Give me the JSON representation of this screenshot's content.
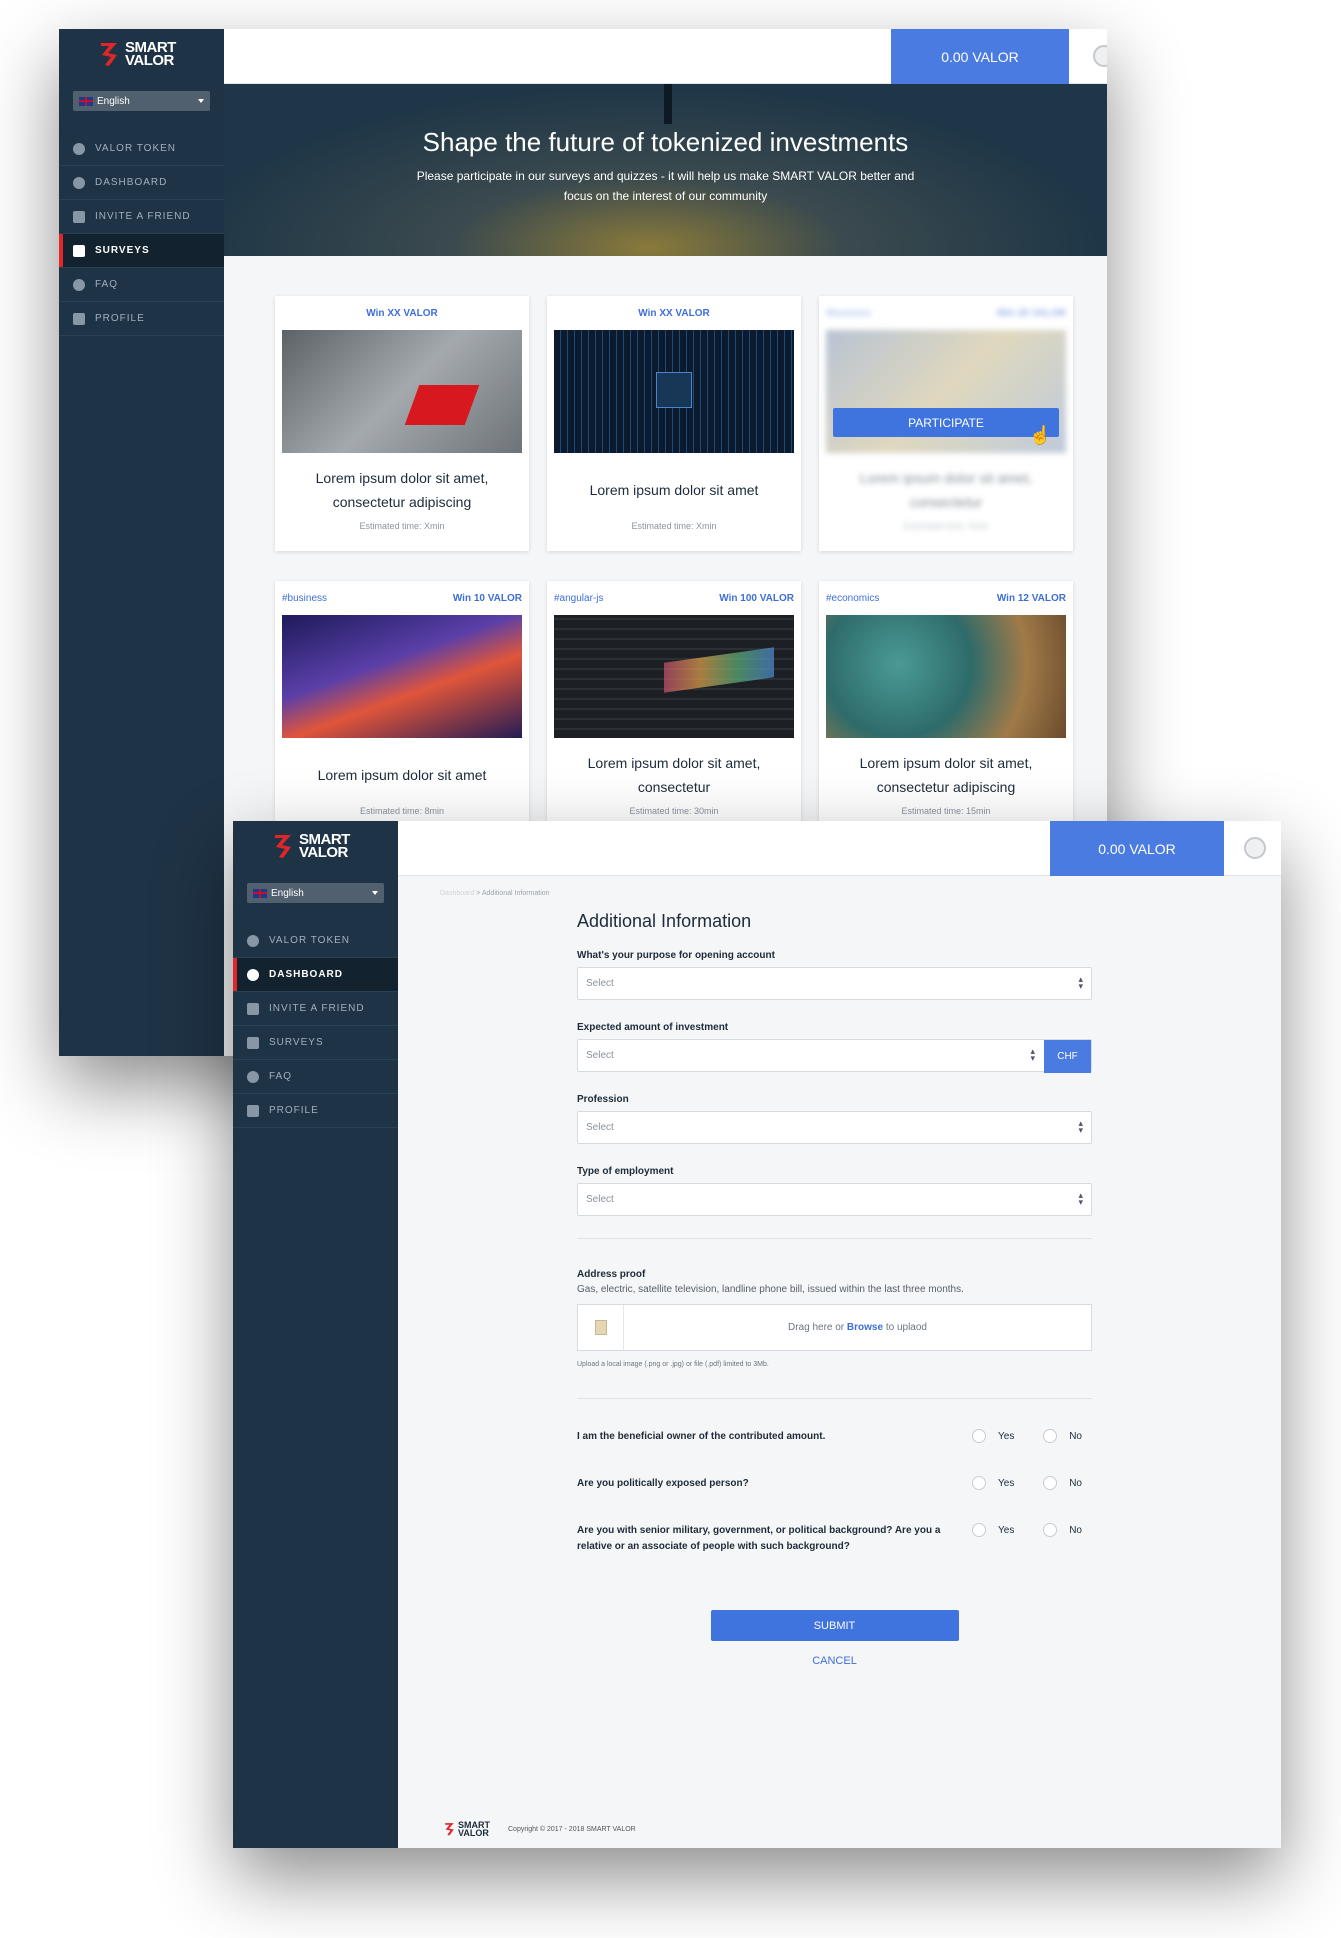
{
  "brand": {
    "logo_line1": "SMART",
    "logo_line2": "VALOR",
    "accent": "#e0262a",
    "primary": "#4a7be0",
    "sidebar_bg": "#1f3346"
  },
  "language": "English",
  "balance": "0.00 VALOR",
  "nav": [
    {
      "label": "VALOR TOKEN",
      "icon": "coin-icon"
    },
    {
      "label": "DASHBOARD",
      "icon": "dashboard-gauge-icon"
    },
    {
      "label": "INVITE A FRIEND",
      "icon": "paper-plane-icon"
    },
    {
      "label": "SURVEYS",
      "icon": "chat-bubble-icon"
    },
    {
      "label": "FAQ",
      "icon": "question-icon"
    },
    {
      "label": "PROFILE",
      "icon": "profile-card-icon"
    }
  ],
  "surveys_page": {
    "hero_title": "Shape the future of tokenized investments",
    "hero_text": "Please participate in our surveys and quizzes - it will help us make SMART VALOR better and focus on the interest of our community",
    "participate_label": "PARTICIPATE",
    "cards": [
      {
        "tag": "",
        "reward": "Win XX VALOR",
        "title": "Lorem ipsum dolor sit amet, consectetur adipiscing",
        "time": "Estimated time: Xmin"
      },
      {
        "tag": "",
        "reward": "Win XX VALOR",
        "title": "Lorem ipsum dolor sit amet",
        "time": "Estimated time: Xmin"
      },
      {
        "tag": "#business",
        "reward": "Win 20 VALOR",
        "title": "Lorem ipsum dolor sit amet, consectetur",
        "time": "Estimated time: Xmin"
      },
      {
        "tag": "#business",
        "reward": "Win 10 VALOR",
        "title": "Lorem ipsum dolor sit amet",
        "time": "Estimated time: 8min"
      },
      {
        "tag": "#angular-js",
        "reward": "Win 100 VALOR",
        "title": "Lorem ipsum dolor sit amet, consectetur",
        "time": "Estimated time: 30min"
      },
      {
        "tag": "#economics",
        "reward": "Win 12 VALOR",
        "title": "Lorem ipsum dolor sit amet, consectetur adipiscing",
        "time": "Estimated time: 15min"
      }
    ]
  },
  "info_page": {
    "breadcrumb_root": "Dashboard",
    "breadcrumb_sep": ">",
    "breadcrumb_current": "Additional Information",
    "title": "Additional Information",
    "fields": [
      {
        "label": "What's your purpose for opening account",
        "placeholder": "Select"
      },
      {
        "label": "Expected amount of investment",
        "placeholder": "Select",
        "currency": "CHF"
      },
      {
        "label": "Profession",
        "placeholder": "Select"
      },
      {
        "label": "Type of employment",
        "placeholder": "Select"
      }
    ],
    "address_label": "Address proof",
    "address_help": "Gas, electric, satellite television, landline phone bill, issued within the last three months.",
    "upload_prefix": "Drag here or",
    "upload_browse": "Browse",
    "upload_suffix": "to uplaod",
    "upload_note": "Upload a local image (.png or .jpg) or file (.pdf) limited to 3Mb.",
    "questions": [
      {
        "text": "I am the beneficial owner of the contributed amount.",
        "yes": "Yes",
        "no": "No"
      },
      {
        "text": "Are you politically exposed person?",
        "yes": "Yes",
        "no": "No"
      },
      {
        "text": "Are you with senior military, government, or political background? Are you a relative or an associate of people with such background?",
        "yes": "Yes",
        "no": "No"
      }
    ],
    "submit": "SUBMIT",
    "cancel": "CANCEL",
    "copyright": "Copyright © 2017 - 2018 SMART VALOR"
  }
}
